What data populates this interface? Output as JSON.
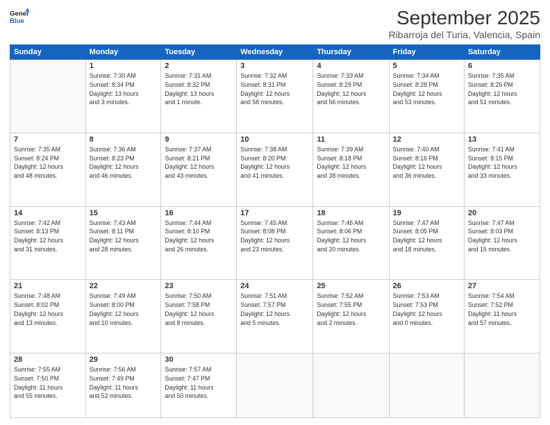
{
  "header": {
    "logo_line1": "General",
    "logo_line2": "Blue",
    "month": "September 2025",
    "location": "Ribarroja del Turia, Valencia, Spain"
  },
  "days_of_week": [
    "Sunday",
    "Monday",
    "Tuesday",
    "Wednesday",
    "Thursday",
    "Friday",
    "Saturday"
  ],
  "weeks": [
    [
      {
        "day": "",
        "info": ""
      },
      {
        "day": "1",
        "info": "Sunrise: 7:30 AM\nSunset: 8:34 PM\nDaylight: 13 hours\nand 3 minutes."
      },
      {
        "day": "2",
        "info": "Sunrise: 7:31 AM\nSunset: 8:32 PM\nDaylight: 13 hours\nand 1 minute."
      },
      {
        "day": "3",
        "info": "Sunrise: 7:32 AM\nSunset: 8:31 PM\nDaylight: 12 hours\nand 58 minutes."
      },
      {
        "day": "4",
        "info": "Sunrise: 7:33 AM\nSunset: 8:29 PM\nDaylight: 12 hours\nand 56 minutes."
      },
      {
        "day": "5",
        "info": "Sunrise: 7:34 AM\nSunset: 8:28 PM\nDaylight: 12 hours\nand 53 minutes."
      },
      {
        "day": "6",
        "info": "Sunrise: 7:35 AM\nSunset: 8:26 PM\nDaylight: 12 hours\nand 51 minutes."
      }
    ],
    [
      {
        "day": "7",
        "info": "Sunrise: 7:35 AM\nSunset: 8:24 PM\nDaylight: 12 hours\nand 48 minutes."
      },
      {
        "day": "8",
        "info": "Sunrise: 7:36 AM\nSunset: 8:23 PM\nDaylight: 12 hours\nand 46 minutes."
      },
      {
        "day": "9",
        "info": "Sunrise: 7:37 AM\nSunset: 8:21 PM\nDaylight: 12 hours\nand 43 minutes."
      },
      {
        "day": "10",
        "info": "Sunrise: 7:38 AM\nSunset: 8:20 PM\nDaylight: 12 hours\nand 41 minutes."
      },
      {
        "day": "11",
        "info": "Sunrise: 7:39 AM\nSunset: 8:18 PM\nDaylight: 12 hours\nand 38 minutes."
      },
      {
        "day": "12",
        "info": "Sunrise: 7:40 AM\nSunset: 8:16 PM\nDaylight: 12 hours\nand 36 minutes."
      },
      {
        "day": "13",
        "info": "Sunrise: 7:41 AM\nSunset: 8:15 PM\nDaylight: 12 hours\nand 33 minutes."
      }
    ],
    [
      {
        "day": "14",
        "info": "Sunrise: 7:42 AM\nSunset: 8:13 PM\nDaylight: 12 hours\nand 31 minutes."
      },
      {
        "day": "15",
        "info": "Sunrise: 7:43 AM\nSunset: 8:11 PM\nDaylight: 12 hours\nand 28 minutes."
      },
      {
        "day": "16",
        "info": "Sunrise: 7:44 AM\nSunset: 8:10 PM\nDaylight: 12 hours\nand 26 minutes."
      },
      {
        "day": "17",
        "info": "Sunrise: 7:45 AM\nSunset: 8:08 PM\nDaylight: 12 hours\nand 23 minutes."
      },
      {
        "day": "18",
        "info": "Sunrise: 7:46 AM\nSunset: 8:06 PM\nDaylight: 12 hours\nand 20 minutes."
      },
      {
        "day": "19",
        "info": "Sunrise: 7:47 AM\nSunset: 8:05 PM\nDaylight: 12 hours\nand 18 minutes."
      },
      {
        "day": "20",
        "info": "Sunrise: 7:47 AM\nSunset: 8:03 PM\nDaylight: 12 hours\nand 15 minutes."
      }
    ],
    [
      {
        "day": "21",
        "info": "Sunrise: 7:48 AM\nSunset: 8:02 PM\nDaylight: 12 hours\nand 13 minutes."
      },
      {
        "day": "22",
        "info": "Sunrise: 7:49 AM\nSunset: 8:00 PM\nDaylight: 12 hours\nand 10 minutes."
      },
      {
        "day": "23",
        "info": "Sunrise: 7:50 AM\nSunset: 7:58 PM\nDaylight: 12 hours\nand 8 minutes."
      },
      {
        "day": "24",
        "info": "Sunrise: 7:51 AM\nSunset: 7:57 PM\nDaylight: 12 hours\nand 5 minutes."
      },
      {
        "day": "25",
        "info": "Sunrise: 7:52 AM\nSunset: 7:55 PM\nDaylight: 12 hours\nand 2 minutes."
      },
      {
        "day": "26",
        "info": "Sunrise: 7:53 AM\nSunset: 7:53 PM\nDaylight: 12 hours\nand 0 minutes."
      },
      {
        "day": "27",
        "info": "Sunrise: 7:54 AM\nSunset: 7:52 PM\nDaylight: 11 hours\nand 57 minutes."
      }
    ],
    [
      {
        "day": "28",
        "info": "Sunrise: 7:55 AM\nSunset: 7:50 PM\nDaylight: 11 hours\nand 55 minutes."
      },
      {
        "day": "29",
        "info": "Sunrise: 7:56 AM\nSunset: 7:49 PM\nDaylight: 11 hours\nand 52 minutes."
      },
      {
        "day": "30",
        "info": "Sunrise: 7:57 AM\nSunset: 7:47 PM\nDaylight: 11 hours\nand 50 minutes."
      },
      {
        "day": "",
        "info": ""
      },
      {
        "day": "",
        "info": ""
      },
      {
        "day": "",
        "info": ""
      },
      {
        "day": "",
        "info": ""
      }
    ]
  ]
}
